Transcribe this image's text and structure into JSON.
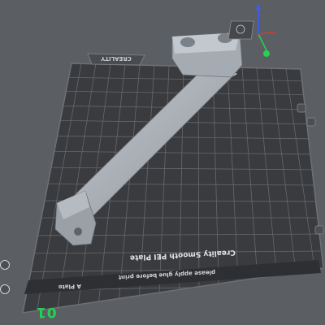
{
  "plate": {
    "brand_label": "CREALITY",
    "plate_name_label": "A Plate",
    "surface_label": "Creality Smooth PEI Plate",
    "note_label": "please apply glue before print",
    "plate_number": "01"
  },
  "colors": {
    "background": "#5b5e63",
    "bed": "#3a3b3e",
    "grid": "#6a6c70",
    "model": "#a9afb6",
    "accent_green": "#22d34f",
    "axis_blue": "#3a5bff",
    "axis_red": "#e03434"
  },
  "icons": [
    "view-cube-icon",
    "axis-gizmo-icon",
    "plate-toolbar-icons"
  ]
}
